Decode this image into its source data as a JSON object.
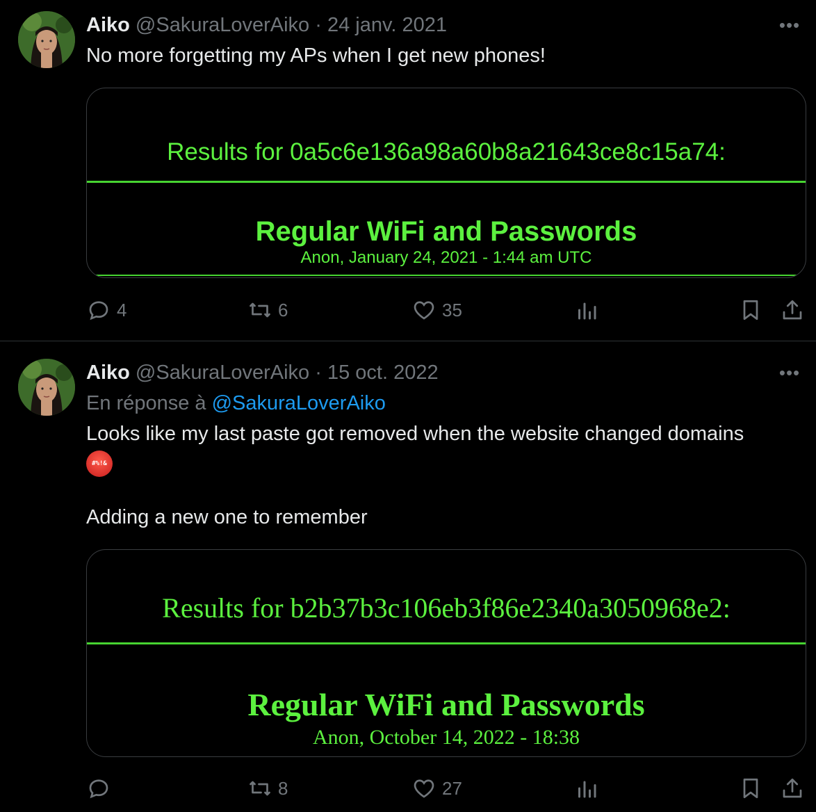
{
  "tweets": [
    {
      "author_name": "Aiko",
      "handle": "@SakuraLoverAiko",
      "separator": "·",
      "date": "24 janv. 2021",
      "more_icon": "more-horizontal-icon",
      "text": "No more forgetting my APs when I get new phones!",
      "card": {
        "results_line": "Results for 0a5c6e136a98a60b8a21643ce8c15a74:",
        "title": "Regular WiFi and Passwords",
        "meta": "Anon, January 24, 2021 - 1:44 am UTC"
      },
      "actions": {
        "reply_count": "4",
        "retweet_count": "6",
        "like_count": "35",
        "views_count": "",
        "icons": [
          "reply-icon",
          "retweet-icon",
          "like-icon",
          "views-icon",
          "bookmark-icon",
          "share-icon"
        ]
      }
    },
    {
      "author_name": "Aiko",
      "handle": "@SakuraLoverAiko",
      "separator": "·",
      "date": "15 oct. 2022",
      "reply_prefix": "En réponse à",
      "reply_mention": "@SakuraLoverAiko",
      "text_line1": "Looks like my last paste got removed when the website changed domains",
      "emoji_glyph": "#%!&",
      "text_line2": "Adding a new one to remember",
      "card": {
        "results_line": "Results for b2b37b3c106eb3f86e2340a3050968e2:",
        "title": "Regular WiFi and Passwords",
        "meta": "Anon, October 14, 2022 - 18:38"
      },
      "actions": {
        "reply_count": "",
        "retweet_count": "8",
        "like_count": "27",
        "views_count": ""
      }
    }
  ],
  "colors": {
    "background": "#000000",
    "text": "#e7e9ea",
    "muted": "#71767b",
    "link": "#1d9bf0",
    "terminal_green": "#5cf13f"
  }
}
